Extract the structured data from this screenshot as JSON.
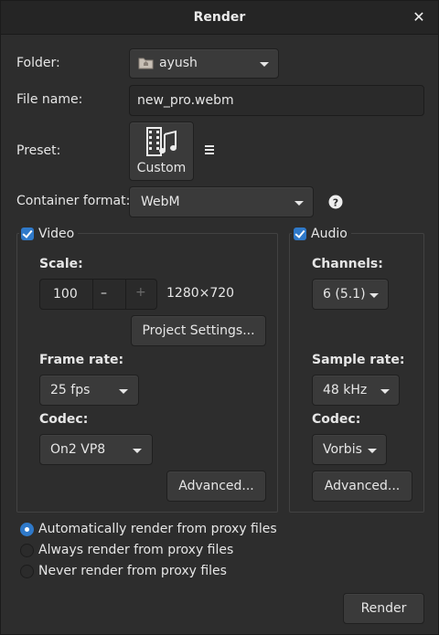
{
  "window": {
    "title": "Render"
  },
  "folder": {
    "label": "Folder:",
    "value": "ayush"
  },
  "file_name": {
    "label": "File name:",
    "value": "new_pro.webm"
  },
  "preset": {
    "label": "Preset:",
    "value": "Custom"
  },
  "container": {
    "label": "Container format:",
    "value": "WebM"
  },
  "video": {
    "label": "Video",
    "scale_label": "Scale:",
    "scale_value": "100",
    "minus": "–",
    "plus": "+",
    "resolution": "1280×720",
    "project_settings": "Project Settings...",
    "frame_rate_label": "Frame rate:",
    "frame_rate": "25 fps",
    "codec_label": "Codec:",
    "codec": "On2 VP8",
    "advanced": "Advanced..."
  },
  "audio": {
    "label": "Audio",
    "channels_label": "Channels:",
    "channels": "6 (5.1)",
    "sample_rate_label": "Sample rate:",
    "sample_rate": "48 kHz",
    "codec_label": "Codec:",
    "codec": "Vorbis",
    "advanced": "Advanced..."
  },
  "proxy_options": [
    "Automatically render from proxy files",
    "Always render from proxy files",
    "Never render from proxy files"
  ],
  "render_button": "Render",
  "colors": {
    "accent": "#2f79c9",
    "background": "#2d2d2d"
  }
}
